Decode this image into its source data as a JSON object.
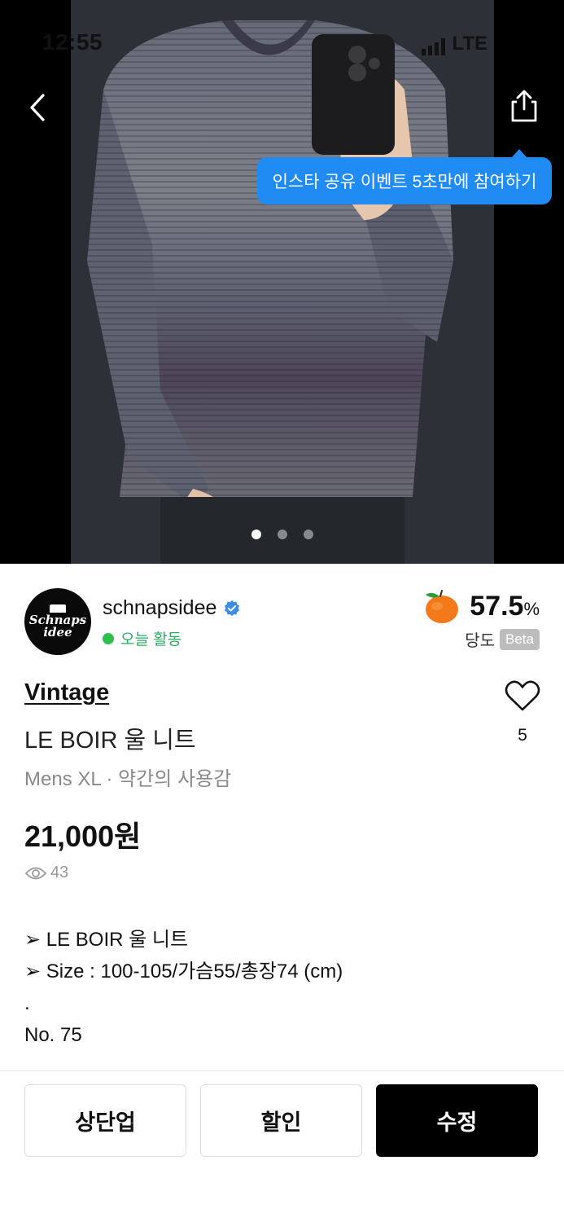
{
  "status_bar": {
    "time": "12:55",
    "network": "LTE"
  },
  "header": {
    "back_icon": "chevron-left-icon",
    "share_icon": "share-icon"
  },
  "tooltip": {
    "text": "인스타 공유 이벤트 5초만에 참여하기",
    "color": "#1f8bf3"
  },
  "carousel": {
    "total": 3,
    "active_index": 0
  },
  "seller": {
    "avatar_text_line1": "Schnaps",
    "avatar_text_line2": "idee",
    "name": "schnapsidee",
    "activity": "오늘 활동",
    "activity_color": "#27ae60"
  },
  "sweetness": {
    "value": "57.5",
    "unit": "%",
    "label": "당도",
    "badge": "Beta",
    "icon": "peach-icon"
  },
  "product": {
    "brand": "Vintage",
    "title": "LE BOIR 울 니트",
    "meta": "Mens XL · 약간의 사용감",
    "price": "21,000원",
    "views": "43",
    "likes": "5"
  },
  "description": [
    "➢ LE BOIR 울 니트",
    "➢ Size : 100-105/가슴55/총장74 (cm)",
    ".",
    "No. 75"
  ],
  "actions": {
    "bump": "상단업",
    "discount": "할인",
    "edit": "수정"
  }
}
